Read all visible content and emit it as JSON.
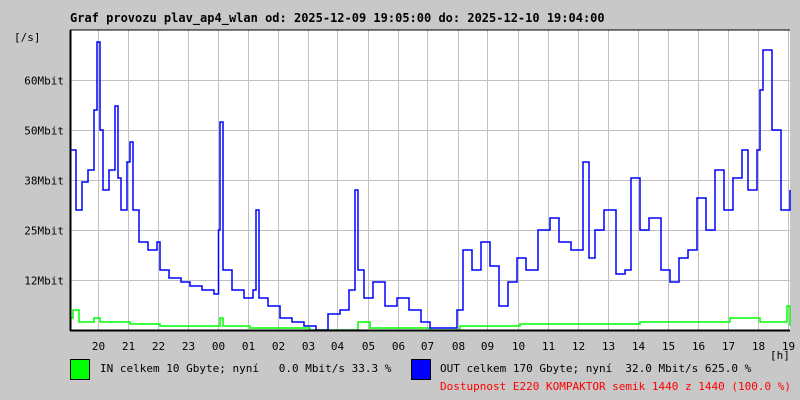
{
  "chart_data": {
    "type": "line",
    "title": "Graf provozu plav_ap4_wlan od: 2025-12-09 19:05:00 do: 2025-12-10 19:04:00",
    "ylabel": "[/s]",
    "xlabel": "[h]",
    "ylim_mbit": [
      0,
      75
    ],
    "xlim_hours_from_start": [
      0,
      24
    ],
    "grid": true,
    "yticks": [
      {
        "value": 12.5,
        "label": "12Mbit"
      },
      {
        "value": 25,
        "label": "25Mbit"
      },
      {
        "value": 37.5,
        "label": "38Mbit"
      },
      {
        "value": 50,
        "label": "50Mbit"
      },
      {
        "value": 62.5,
        "label": "60Mbit"
      }
    ],
    "xticks": [
      "20",
      "21",
      "22",
      "23",
      "00",
      "01",
      "02",
      "03",
      "04",
      "05",
      "06",
      "07",
      "08",
      "09",
      "10",
      "11",
      "12",
      "13",
      "14",
      "15",
      "16",
      "17",
      "18",
      "19"
    ],
    "start_minute_offset": 5,
    "series": [
      {
        "name": "IN",
        "color": "#00ff00",
        "t": [
          0,
          0.1,
          0.3,
          0.8,
          1.0,
          1.5,
          2.0,
          3.0,
          4.0,
          4.9,
          5.0,
          5.1,
          6.0,
          8.0,
          9.6,
          10.0,
          12.0,
          13.0,
          15.0,
          17.0,
          19.0,
          21.0,
          22.0,
          23.0,
          23.9,
          24.0
        ],
        "values": [
          3,
          5,
          2,
          3,
          2,
          2,
          1.5,
          1,
          1,
          1,
          3,
          1,
          0.5,
          0,
          2,
          0.5,
          0,
          1,
          1.5,
          1.5,
          2,
          2,
          3,
          2,
          6,
          1
        ]
      },
      {
        "name": "OUT",
        "color": "#0000ff",
        "t": [
          0,
          0.2,
          0.4,
          0.6,
          0.8,
          0.9,
          1.0,
          1.1,
          1.3,
          1.5,
          1.6,
          1.7,
          1.9,
          2.0,
          2.1,
          2.3,
          2.6,
          2.9,
          3.0,
          3.3,
          3.7,
          4.0,
          4.4,
          4.8,
          4.95,
          5.0,
          5.1,
          5.4,
          5.8,
          6.1,
          6.2,
          6.3,
          6.6,
          7.0,
          7.4,
          7.8,
          8.2,
          8.6,
          9.0,
          9.3,
          9.5,
          9.6,
          9.8,
          10.1,
          10.5,
          10.9,
          11.3,
          11.7,
          12.0,
          12.5,
          12.9,
          13.1,
          13.4,
          13.7,
          14.0,
          14.3,
          14.6,
          14.9,
          15.2,
          15.6,
          16.0,
          16.3,
          16.7,
          17.1,
          17.3,
          17.5,
          17.8,
          18.2,
          18.5,
          18.7,
          19.0,
          19.3,
          19.7,
          20.0,
          20.3,
          20.6,
          20.9,
          21.2,
          21.5,
          21.8,
          22.1,
          22.4,
          22.6,
          22.9,
          23.0,
          23.1,
          23.4,
          23.7,
          24.0
        ],
        "values": [
          45,
          30,
          37,
          40,
          55,
          72,
          50,
          35,
          40,
          56,
          38,
          30,
          42,
          47,
          30,
          22,
          20,
          22,
          15,
          13,
          12,
          11,
          10,
          9,
          25,
          52,
          15,
          10,
          8,
          10,
          30,
          8,
          6,
          3,
          2,
          1,
          0,
          4,
          5,
          10,
          35,
          15,
          8,
          12,
          6,
          8,
          5,
          2,
          0.5,
          0.5,
          5,
          20,
          15,
          22,
          16,
          6,
          12,
          18,
          15,
          25,
          28,
          22,
          20,
          42,
          18,
          25,
          30,
          14,
          15,
          38,
          25,
          28,
          15,
          12,
          18,
          20,
          33,
          25,
          40,
          30,
          38,
          45,
          35,
          45,
          60,
          70,
          50,
          30,
          35,
          32
        ]
      }
    ],
    "legend": {
      "in_text": "IN celkem 10 Gbyte; nyní   0.0 Mbit/s 33.3 %",
      "out_text": "OUT celkem 170 Gbyte; nyní  32.0 Mbit/s 625.0 %",
      "availability": "Dostupnost E220 KOMPAKTOR semik 1440 z 1440 (100.0 %)"
    }
  }
}
